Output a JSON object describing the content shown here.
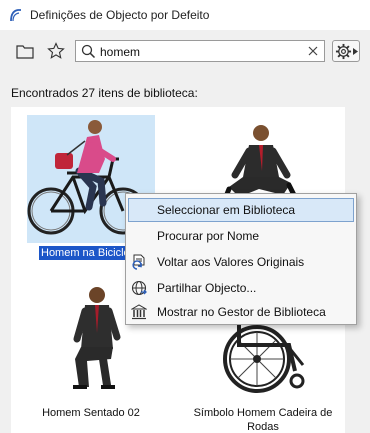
{
  "window": {
    "title": "Definições de Objecto por Defeito"
  },
  "search": {
    "value": "homem"
  },
  "results": {
    "count_text": "Encontrados 27 itens de biblioteca:",
    "items": [
      {
        "label": "Homem na Bicicleta",
        "selected": true
      },
      {
        "label": ""
      },
      {
        "label": "Homem Sentado 02"
      },
      {
        "label": "Símbolo Homem Cadeira de Rodas"
      }
    ]
  },
  "context_menu": {
    "items": [
      {
        "label": "Seleccionar em Biblioteca",
        "icon": "none",
        "highlighted": true
      },
      {
        "label": "Procurar por Nome",
        "icon": "none"
      },
      {
        "label": "Voltar aos Valores Originais",
        "icon": "reset-document-icon"
      },
      {
        "label": "Partilhar Objecto...",
        "icon": "globe-share-icon"
      },
      {
        "label": "Mostrar no Gestor de Biblioteca",
        "icon": "library-manager-icon"
      }
    ]
  },
  "colors": {
    "selection": "#1c56c8",
    "selection_thumb_bg": "#cfe6f8",
    "menu_highlight": "#d8e8f8"
  }
}
